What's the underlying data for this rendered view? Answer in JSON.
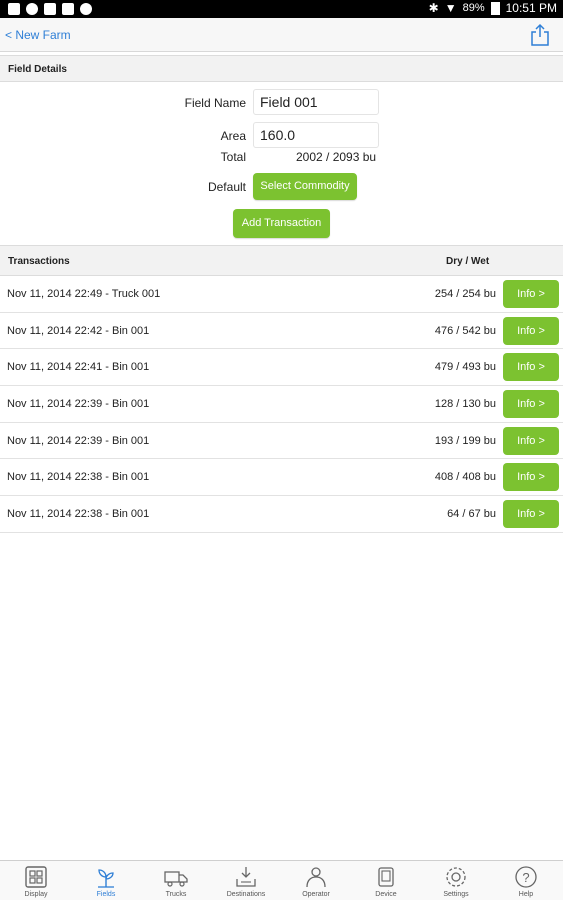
{
  "status_bar": {
    "battery": "89%",
    "time": "10:51 PM"
  },
  "nav": {
    "back_label": "< New Farm",
    "share_icon": "share-icon"
  },
  "field_details": {
    "section_title": "Field Details",
    "field_name_label": "Field Name",
    "field_name_value": "Field 001",
    "area_label": "Area",
    "area_value": "160.0",
    "total_label": "Total",
    "total_value": "2002 / 2093 bu",
    "default_label": "Default",
    "select_commodity_label": "Select Commodity",
    "add_transaction_label": "Add Transaction"
  },
  "transactions": {
    "section_title": "Transactions",
    "dry_wet_header": "Dry / Wet",
    "info_label": "Info >",
    "rows": [
      {
        "desc": "Nov 11, 2014 22:49 - Truck 001",
        "qty": "254 / 254 bu"
      },
      {
        "desc": "Nov 11, 2014 22:42 - Bin 001",
        "qty": "476 / 542 bu"
      },
      {
        "desc": "Nov 11, 2014 22:41 - Bin 001",
        "qty": "479 / 493 bu"
      },
      {
        "desc": "Nov 11, 2014 22:39 - Bin 001",
        "qty": "128 / 130 bu"
      },
      {
        "desc": "Nov 11, 2014 22:39 - Bin 001",
        "qty": "193 / 199 bu"
      },
      {
        "desc": "Nov 11, 2014 22:38 - Bin 001",
        "qty": "408 / 408 bu"
      },
      {
        "desc": "Nov 11, 2014 22:38 - Bin 001",
        "qty": "64 / 67 bu"
      }
    ]
  },
  "tabs": [
    {
      "label": "Display",
      "icon": "display-icon",
      "active": false
    },
    {
      "label": "Fields",
      "icon": "plant-icon",
      "active": true
    },
    {
      "label": "Trucks",
      "icon": "truck-icon",
      "active": false
    },
    {
      "label": "Destinations",
      "icon": "destination-icon",
      "active": false
    },
    {
      "label": "Operator",
      "icon": "operator-icon",
      "active": false
    },
    {
      "label": "Device",
      "icon": "device-icon",
      "active": false
    },
    {
      "label": "Settings",
      "icon": "gear-icon",
      "active": false
    },
    {
      "label": "Help",
      "icon": "help-icon",
      "active": false
    }
  ],
  "colors": {
    "accent_green": "#7cc230",
    "link_blue": "#2f7fd6"
  }
}
